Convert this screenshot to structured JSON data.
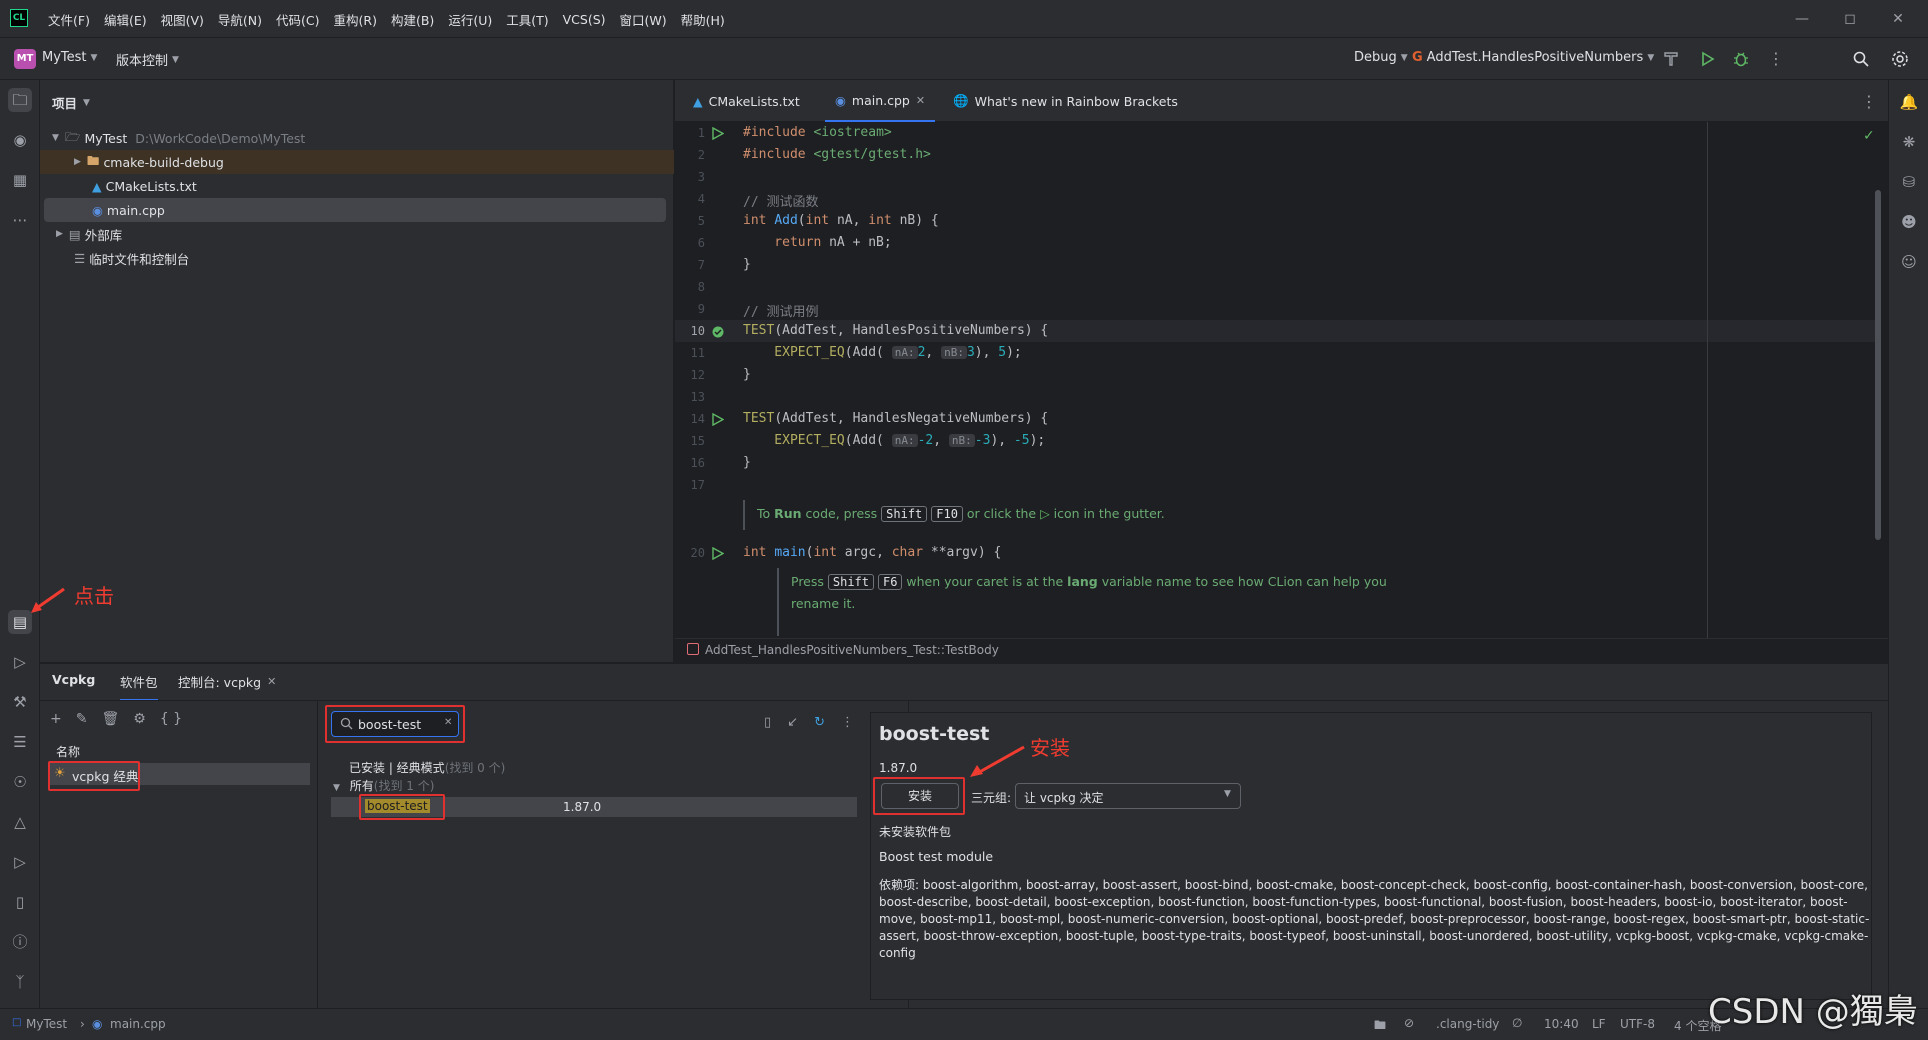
{
  "menu": [
    "文件(F)",
    "编辑(E)",
    "视图(V)",
    "导航(N)",
    "代码(C)",
    "重构(R)",
    "构建(B)",
    "运行(U)",
    "工具(T)",
    "VCS(S)",
    "窗口(W)",
    "帮助(H)"
  ],
  "app_logo": "CL",
  "toolbar": {
    "project_badge": "MT",
    "project_name": "MyTest",
    "vcs_label": "版本控制",
    "build_config": "Debug",
    "run_config": "AddTest.HandlesPositiveNumbers"
  },
  "project_panel": {
    "title": "项目",
    "root_name": "MyTest",
    "root_path": "D:\\WorkCode\\Demo\\MyTest",
    "items": [
      "cmake-build-debug",
      "CMakeLists.txt",
      "main.cpp",
      "外部库",
      "临时文件和控制台"
    ]
  },
  "editor": {
    "tabs": [
      "CMakeLists.txt",
      "main.cpp",
      "What's new in Rainbow Brackets"
    ],
    "line_numbers": [
      "1",
      "2",
      "3",
      "4",
      "5",
      "6",
      "7",
      "8",
      "9",
      "10",
      "11",
      "12",
      "13",
      "14",
      "15",
      "16",
      "17",
      "20"
    ],
    "code": {
      "l1a": "#include ",
      "l1b": "<iostream>",
      "l2a": "#include ",
      "l2b": "<gtest/gtest.h>",
      "l4": "// 测试函数",
      "l5a": "int ",
      "l5b": "Add",
      "l5c": "(",
      "l5d": "int ",
      "l5e": "nA, ",
      "l5f": "int ",
      "l5g": "nB) {",
      "l6a": "    return ",
      "l6b": "nA + nB;",
      "l7": "}",
      "l9": "// 测试用例",
      "l10a": "TEST",
      "l10b": "(AddTest, HandlesPositiveNumbers) {",
      "l11a": "    EXPECT_EQ",
      "l11b": "(Add( ",
      "l11h1": "nA:",
      "l11c": "2",
      "l11d": ", ",
      "l11h2": "nB:",
      "l11e": "3",
      "l11f": "), ",
      "l11g": "5",
      "l11i": ");",
      "l12": "}",
      "l14a": "TEST",
      "l14b": "(AddTest, HandlesNegativeNumbers) {",
      "l15a": "    EXPECT_EQ",
      "l15b": "(Add( ",
      "l15h1": "nA:",
      "l15c": "-2",
      "l15d": ", ",
      "l15h2": "nB:",
      "l15e": "-3",
      "l15f": "), ",
      "l15g": "-5",
      "l15i": ");",
      "l16": "}",
      "l20a": "int ",
      "l20b": "main",
      "l20c": "(",
      "l20d": "int ",
      "l20e": "argc, ",
      "l20f": "char ",
      "l20g": "**argv) {"
    },
    "tip1": {
      "a": "To ",
      "b": "Run",
      "c": " code, press ",
      "k1": "Shift",
      "k2": "F10",
      "d": " or click the ",
      "e": " icon in the gutter."
    },
    "tip2": {
      "a": "Press ",
      "k1": "Shift",
      "k2": "F6",
      "b": " when your caret is at the ",
      "c": "lang",
      "d": " variable name to see how CLion can help you",
      "e": "rename it."
    },
    "breadcrumb": "AddTest_HandlesPositiveNumbers_Test::TestBody"
  },
  "annotations": {
    "click": "点击",
    "install": "安装"
  },
  "bottom": {
    "tabs": [
      "Vcpkg",
      "软件包",
      "控制台: vcpkg"
    ],
    "name_header": "名称",
    "registry": "vcpkg 经典",
    "search_value": "boost-test",
    "installed_group": "已安装 | 经典模式",
    "installed_count": "(找到 0 个)",
    "all_group": "所有",
    "all_count": "(找到 1 个)",
    "result_name": "boost-test",
    "result_version": "1.87.0",
    "detail": {
      "title": "boost-test",
      "version": "1.87.0",
      "install_btn": "安装",
      "triplet_label": "三元组:",
      "triplet_value": "让 vcpkg 决定",
      "status": "未安装软件包",
      "description": "Boost test module",
      "deps_lines": [
        "依赖项: boost-algorithm, boost-array, boost-assert, boost-bind, boost-cmake, boost-concept-check, boost-config, boost-container-hash, boost-conversion, boost-core,",
        "boost-describe, boost-detail, boost-exception, boost-function, boost-function-types, boost-functional, boost-fusion, boost-headers, boost-io, boost-iterator, boost-",
        "move, boost-mp11, boost-mpl, boost-numeric-conversion, boost-optional, boost-predef, boost-preprocessor, boost-range, boost-regex, boost-smart-ptr, boost-static-",
        "assert, boost-throw-exception, boost-tuple, boost-type-traits, boost-typeof, boost-uninstall, boost-unordered, boost-utility, vcpkg-boost, vcpkg-cmake, vcpkg-cmake-",
        "config"
      ]
    }
  },
  "statusbar": {
    "project": "MyTest",
    "file": "main.cpp",
    "linter": ".clang-tidy",
    "position": "10:40",
    "line_sep": "LF",
    "encoding": "UTF-8",
    "indent": "4 个空格"
  },
  "watermark": "CSDN @獨梟",
  "colors": {
    "accent": "#3574f0",
    "annotation_red": "#e0302f",
    "panel_bg": "#2b2d30",
    "editor_bg": "#1e1f22"
  }
}
